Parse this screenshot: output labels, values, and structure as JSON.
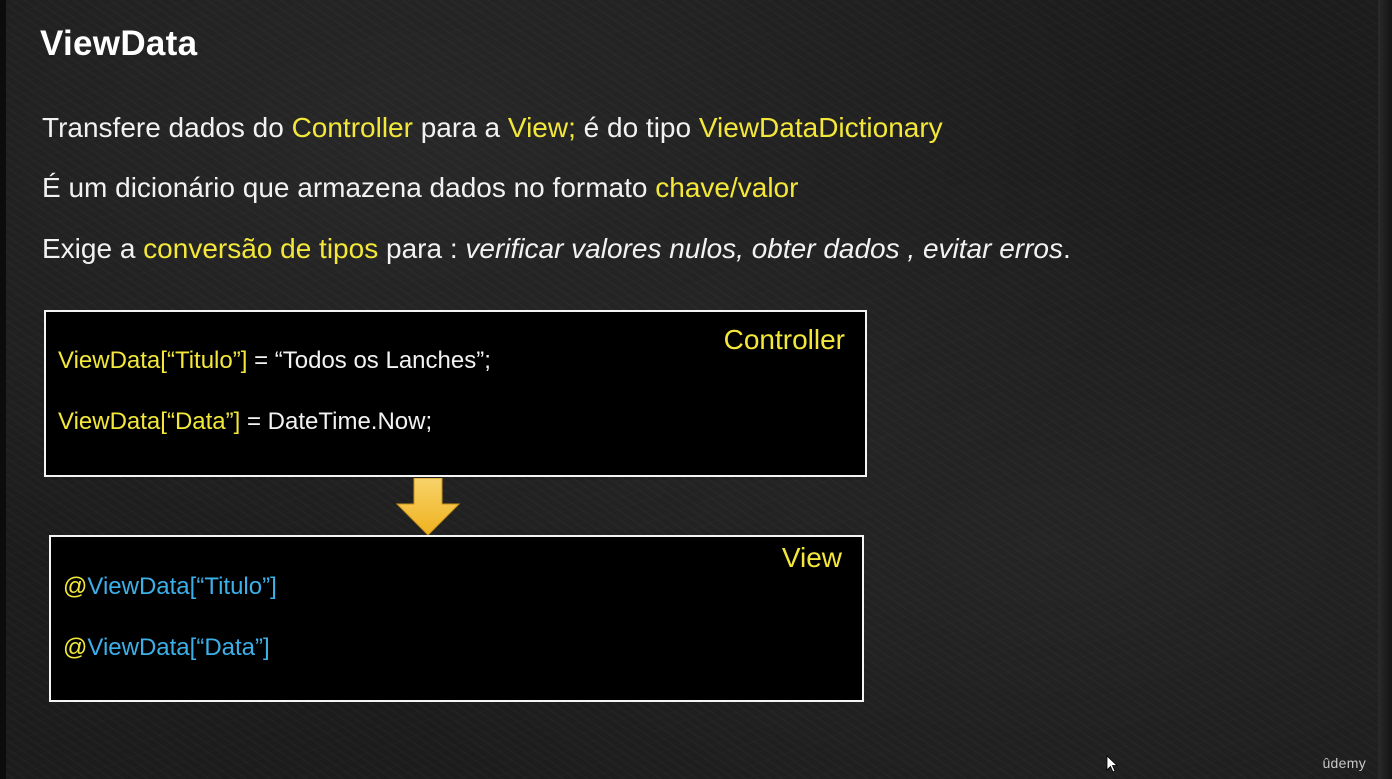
{
  "slide": {
    "title": "ViewData",
    "line1": {
      "part1": "Transfere dados do ",
      "hl1": "Controller",
      "part2": " para a ",
      "hl2": "View;",
      "part3": " é do tipo ",
      "hl3": "ViewDataDictionary"
    },
    "line2": {
      "part1": "É um dicionário  que armazena dados no formato ",
      "hl1": "chave/valor"
    },
    "line3": {
      "part1": "Exige a ",
      "hl1": "conversão de tipos",
      "part2": " para : ",
      "it1": "verificar valores nulos, obter dados , evitar erros",
      "part3": "."
    }
  },
  "controller_box": {
    "label": "Controller",
    "code_lines": [
      {
        "key": "ViewData[“Titulo”]",
        "rest": " = “Todos os Lanches”;"
      },
      {
        "key": "ViewData[“Data”]",
        "rest": " = DateTime.Now;"
      }
    ]
  },
  "view_box": {
    "label": "View",
    "code_lines": [
      {
        "at": "@",
        "expr": "ViewData[“Titulo”]"
      },
      {
        "at": "@",
        "expr": "ViewData[“Data”]"
      }
    ]
  },
  "watermark": "ûdemy",
  "colors": {
    "highlight": "#f3e83a",
    "razor_blue": "#3cb0e8",
    "arrow": "#f4c430",
    "board": "#1c1c1c"
  },
  "icons": {
    "arrow": "down-arrow-icon",
    "cursor": "mouse-pointer-icon"
  }
}
